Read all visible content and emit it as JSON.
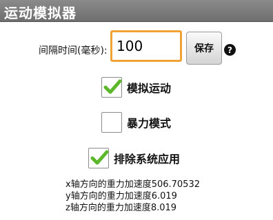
{
  "window": {
    "title": "运动模拟器"
  },
  "interval": {
    "label": "间隔时间(毫秒):",
    "value": "100"
  },
  "buttons": {
    "save_label": "保存"
  },
  "icons": {
    "help": "help-icon",
    "check": "check-icon"
  },
  "options": [
    {
      "label": "模拟运动",
      "checked": true
    },
    {
      "label": "暴力模式",
      "checked": false
    },
    {
      "label": "排除系统应用",
      "checked": true
    }
  ],
  "gravity": [
    "x轴方向的重力加速度506.70532",
    "y轴方向的重力加速度6.019",
    "z轴方向的重力加速度8.019"
  ],
  "colors": {
    "accent": "#f1a234",
    "check": "#5cb82a",
    "titlebar": "#7d7d7d"
  }
}
